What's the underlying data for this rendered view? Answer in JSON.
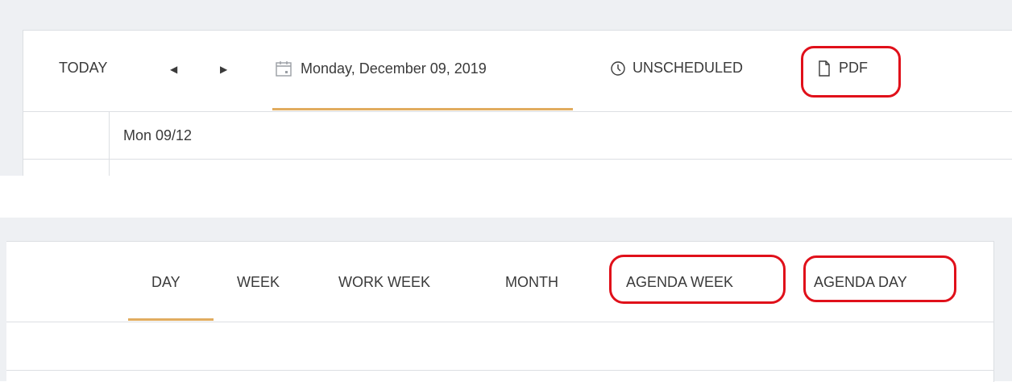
{
  "toolbar": {
    "today_label": "TODAY",
    "prev_icon": "◀",
    "next_icon": "▶",
    "date_label": "Monday, December 09, 2019",
    "unscheduled_label": "UNSCHEDULED",
    "pdf_label": "PDF"
  },
  "grid": {
    "day_header": "Mon 09/12"
  },
  "views": {
    "day": "DAY",
    "week": "WEEK",
    "work_week": "WORK WEEK",
    "month": "MONTH",
    "agenda_week": "AGENDA WEEK",
    "agenda_day": "AGENDA DAY",
    "selected": "DAY"
  },
  "colors": {
    "accent_underline": "#e1ac5f",
    "annotation_red": "#e0101a",
    "text": "#3a3a3a",
    "panel_bg": "#eef0f3",
    "border": "#dcdfe3"
  },
  "icons": {
    "calendar": "calendar-icon",
    "clock": "clock-icon",
    "document": "document-icon",
    "prev": "caret-left-icon",
    "next": "caret-right-icon"
  }
}
